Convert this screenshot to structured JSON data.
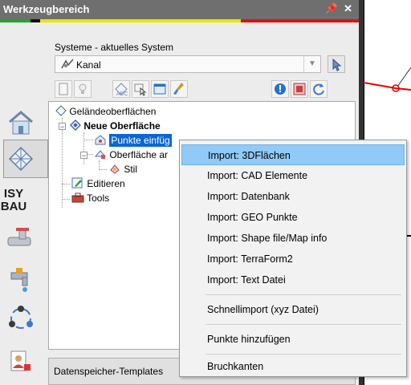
{
  "window": {
    "title": "Werkzeugbereich",
    "pin_glyph": "❀",
    "close_glyph": "×"
  },
  "colors": {
    "green": "#1fa52b",
    "yellow": "#e6e600",
    "red": "#e01010",
    "titlebar": "#6f6f6f",
    "highlight": "#91c9f7",
    "tree_selected": "#0a66d6"
  },
  "system": {
    "label": "Systeme - aktuelles System",
    "selected": "Kanal",
    "icon": "pipe-icon"
  },
  "sidebar": {
    "brand_line1": "ISY",
    "brand_line2": "BAU"
  },
  "tree": {
    "root": "Geländeoberflächen",
    "surface": "Neue Oberfläche",
    "points": "Punkte einfüg",
    "surface_edit": "Oberfläche ar",
    "style": "Stil",
    "edit": "Editieren",
    "tools": "Tools"
  },
  "context_menu": {
    "items": [
      "Import: 3DFlächen",
      "Import: CAD Elemente",
      "Import: Datenbank",
      "Import: GEO Punkte",
      "Import: Shape file/Map info",
      "Import: TerraForm2",
      "Import: Text Datei",
      "Schnellimport (xyz Datei)",
      "Punkte hinzufügen",
      "Bruchkanten"
    ]
  },
  "lower_panel": {
    "label": "Datenspeicher-Templates"
  }
}
